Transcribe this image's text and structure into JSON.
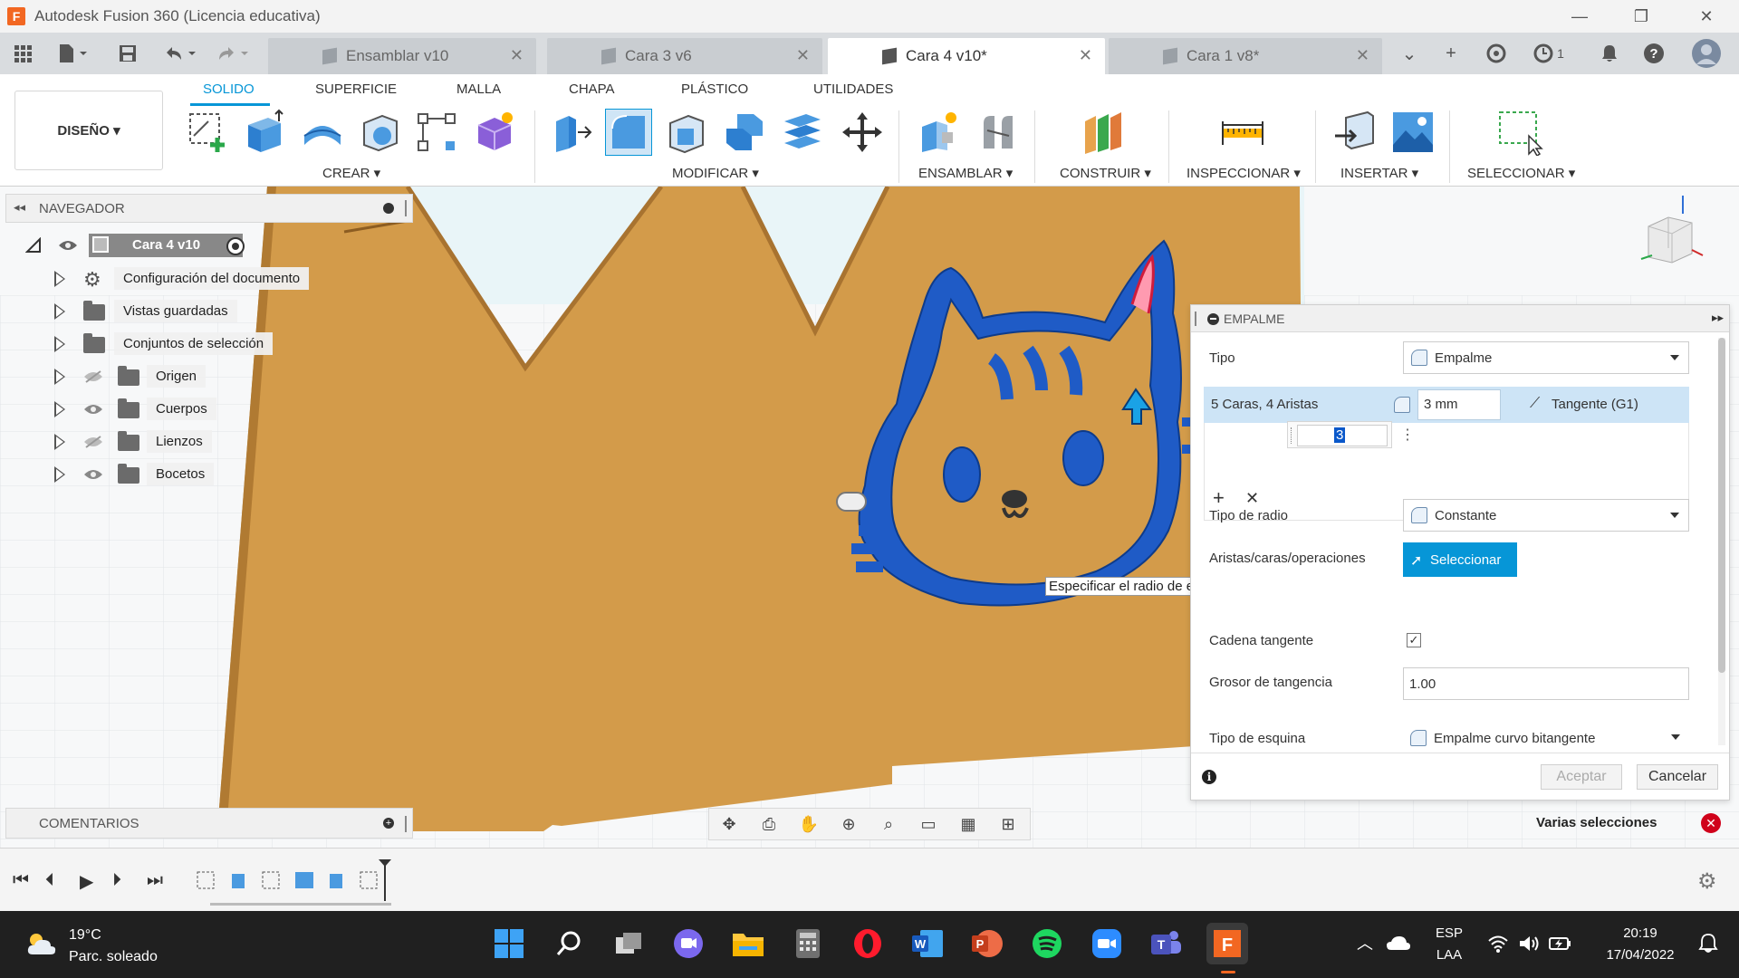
{
  "app": {
    "title": "Autodesk Fusion 360 (Licencia educativa)",
    "logo_letter": "F",
    "window_controls": [
      "—",
      "❐",
      "✕"
    ]
  },
  "tabs": [
    {
      "label": "Ensamblar v10",
      "active": false
    },
    {
      "label": "Cara 3 v6",
      "active": false
    },
    {
      "label": "Cara 4 v10*",
      "active": true
    },
    {
      "label": "Cara 1 v8*",
      "active": false
    }
  ],
  "tabbar_right": {
    "job_count": "1"
  },
  "ribbon": {
    "workspace": "DISEÑO ▾",
    "tabs": [
      "SOLIDO",
      "SUPERFICIE",
      "MALLA",
      "CHAPA",
      "PLÁSTICO",
      "UTILIDADES"
    ],
    "groups": [
      "CREAR ▾",
      "MODIFICAR ▾",
      "ENSAMBLAR ▾",
      "CONSTRUIR ▾",
      "INSPECCIONAR ▾",
      "INSERTAR ▾",
      "SELECCIONAR ▾"
    ]
  },
  "navigator": {
    "title": "NAVEGADOR",
    "root": "Cara 4 v10",
    "items": [
      {
        "label": "Configuración del documento"
      },
      {
        "label": "Vistas guardadas"
      },
      {
        "label": "Conjuntos de selección"
      },
      {
        "label": "Origen"
      },
      {
        "label": "Cuerpos"
      },
      {
        "label": "Lienzos"
      },
      {
        "label": "Bocetos"
      }
    ]
  },
  "comments": {
    "title": "COMENTARIOS"
  },
  "tooltip": "Especificar el radio de empalme",
  "dialog": {
    "title": "EMPALME",
    "tipo_label": "Tipo",
    "tipo_value": "Empalme",
    "selection_text": "5 Caras, 4 Aristas",
    "radius_value": "3 mm",
    "tangent_value": "Tangente (G1)",
    "mini_value": "3",
    "add_symbol": "+",
    "remove_symbol": "✕",
    "tipo_radio_label": "Tipo de radio",
    "tipo_radio_value": "Constante",
    "aristas_label": "Aristas/caras/operaciones",
    "seleccionar_label": "Seleccionar",
    "cadena_label": "Cadena tangente",
    "cadena_checked": "✓",
    "grosor_label": "Grosor de tangencia",
    "grosor_value": "1.00",
    "esquina_label": "Tipo de esquina",
    "esquina_value": "Empalme curvo bitangente",
    "info_symbol": "i",
    "aceptar_label": "Aceptar",
    "cancelar_label": "Cancelar"
  },
  "status": {
    "selection": "Varias selecciones",
    "close_symbol": "✕"
  },
  "taskbar": {
    "temperature": "19°C",
    "weather": "Parc. soleado",
    "lang": "ESP",
    "region": "LAA",
    "time": "20:19",
    "date": "17/04/2022"
  },
  "colors": {
    "accent": "#0696d7",
    "wood": "#d39b4a",
    "cat_blue": "#1f5bc6",
    "taskbar": "#202020"
  }
}
